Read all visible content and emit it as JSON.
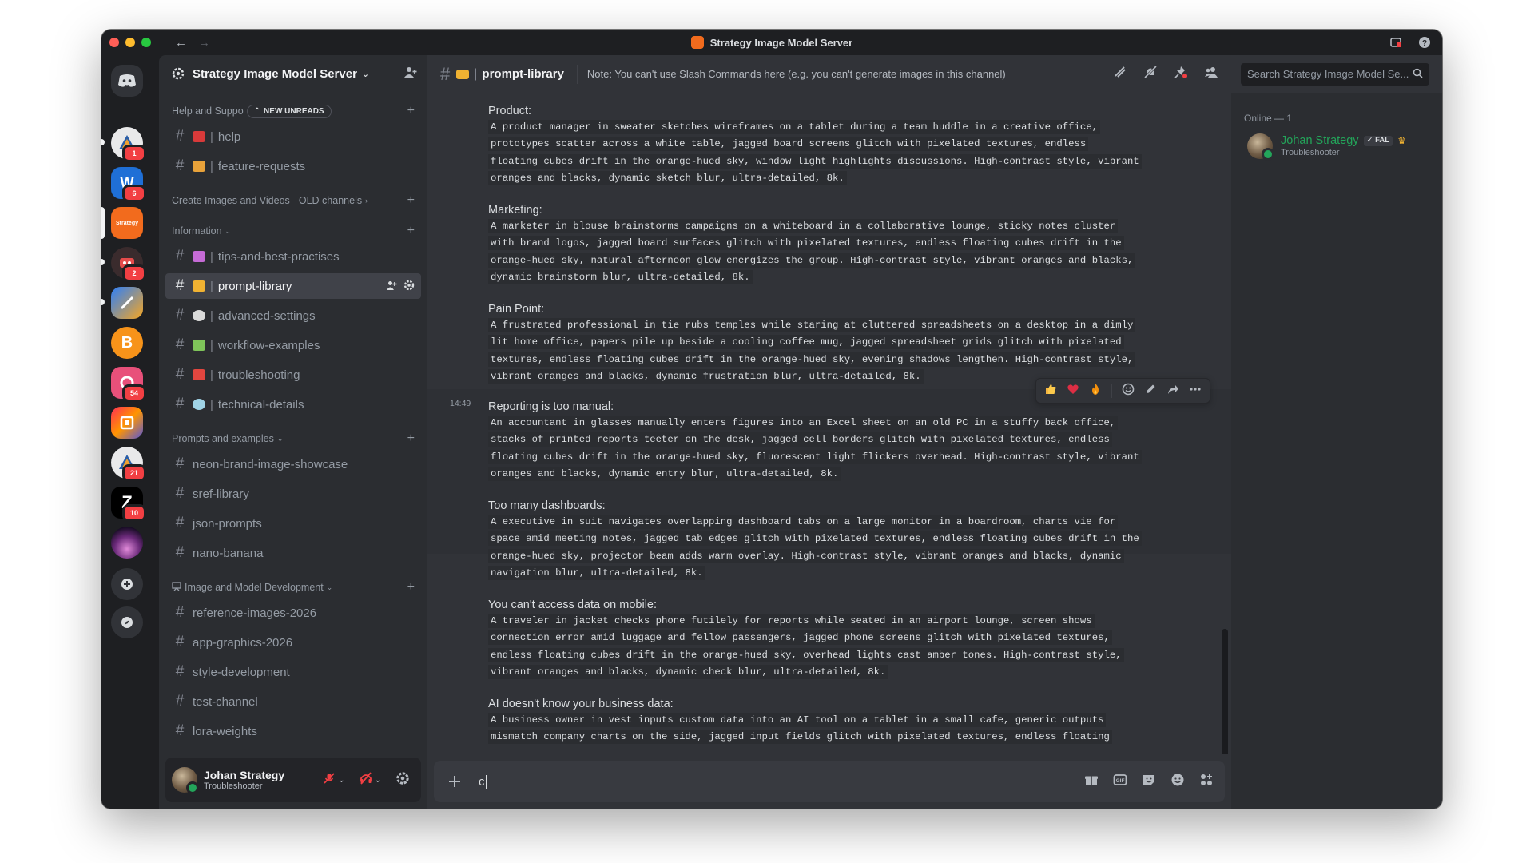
{
  "window": {
    "title": "Strategy Image Model Server"
  },
  "rail": {
    "servers": [
      {
        "name": "discord-home",
        "badge": ""
      },
      {
        "name": "server-1",
        "badge": "1"
      },
      {
        "name": "server-2",
        "badge": "6"
      },
      {
        "name": "strategy-server",
        "badge": ""
      },
      {
        "name": "server-4",
        "badge": "2"
      },
      {
        "name": "server-5",
        "badge": ""
      },
      {
        "name": "server-6",
        "badge": ""
      },
      {
        "name": "server-7",
        "badge": "54"
      },
      {
        "name": "server-8",
        "badge": ""
      },
      {
        "name": "server-9",
        "badge": "21"
      },
      {
        "name": "server-10",
        "badge": "10"
      },
      {
        "name": "server-11",
        "badge": ""
      }
    ],
    "strategy_logo_text": "Strategy"
  },
  "sidebar": {
    "server_name": "Strategy Image Model Server",
    "categories": {
      "help": {
        "label": "Help and Suppo",
        "new_unreads": "NEW UNREADS"
      },
      "create": {
        "label": "Create Images and Videos - OLD channels"
      },
      "information": {
        "label": "Information"
      },
      "prompts": {
        "label": "Prompts and examples"
      },
      "dev": {
        "label": "Image and Model Development"
      }
    },
    "channels": {
      "help": "help",
      "feature_requests": "feature-requests",
      "tips": "tips-and-best-practises",
      "prompt_library": "prompt-library",
      "advanced_settings": "advanced-settings",
      "workflow_examples": "workflow-examples",
      "troubleshooting": "troubleshooting",
      "technical_details": "technical-details",
      "neon": "neon-brand-image-showcase",
      "sref": "sref-library",
      "json": "json-prompts",
      "nano": "nano-banana",
      "reference": "reference-images-2026",
      "app_graphics": "app-graphics-2026",
      "style_dev": "style-development",
      "test_channel": "test-channel",
      "lora": "lora-weights"
    },
    "user": {
      "name": "Johan Strategy",
      "status": "Troubleshooter"
    }
  },
  "chat": {
    "channel_name": "prompt-library",
    "topic": "Note: You can't use Slash Commands here (e.g. you can't generate images in this channel)",
    "search_placeholder": "Search Strategy Image Model Se...",
    "timestamp": "14:49",
    "composer_value": "c",
    "blocks": [
      {
        "label": "Product:",
        "lines": [
          "A product manager in sweater sketches wireframes on a tablet during a team huddle in a creative office,",
          "prototypes scatter across a white table, jagged board screens glitch with pixelated textures, endless",
          "floating cubes drift in the orange-hued sky, window light highlights discussions. High-contrast style, vibrant",
          "oranges and blacks, dynamic sketch blur, ultra-detailed, 8k."
        ]
      },
      {
        "label": "Marketing:",
        "lines": [
          "A marketer in blouse brainstorms campaigns on a whiteboard in a collaborative lounge, sticky notes cluster",
          "with brand logos, jagged board surfaces glitch with pixelated textures, endless floating cubes drift in the",
          "orange-hued sky, natural afternoon glow energizes the group. High-contrast style, vibrant oranges and blacks,",
          "dynamic brainstorm blur, ultra-detailed, 8k."
        ]
      },
      {
        "label": "Pain Point:",
        "lines": [
          "A frustrated professional in tie rubs temples while staring at cluttered spreadsheets on a desktop in a dimly",
          "lit home office, papers pile up beside a cooling coffee mug, jagged spreadsheet grids glitch with pixelated",
          "textures, endless floating cubes drift in the orange-hued sky, evening shadows lengthen. High-contrast style,",
          "vibrant oranges and blacks, dynamic frustration blur, ultra-detailed, 8k."
        ]
      },
      {
        "label": "Reporting is too manual:",
        "lines": [
          "An accountant in glasses manually enters figures into an Excel sheet on an old PC in a stuffy back office,",
          "stacks of printed reports teeter on the desk, jagged cell borders glitch with pixelated textures, endless",
          "floating cubes drift in the orange-hued sky, fluorescent light flickers overhead. High-contrast style, vibrant",
          "oranges and blacks, dynamic entry blur, ultra-detailed, 8k."
        ]
      },
      {
        "label": "Too many dashboards:",
        "lines": [
          "A executive in suit navigates overlapping dashboard tabs on a large monitor in a boardroom, charts vie for",
          "space amid meeting notes, jagged tab edges glitch with pixelated textures, endless floating cubes drift in the",
          "orange-hued sky, projector beam adds warm overlay. High-contrast style, vibrant oranges and blacks, dynamic",
          "navigation blur, ultra-detailed, 8k."
        ]
      },
      {
        "label": "You can't access data on mobile:",
        "lines": [
          "A traveler in jacket checks phone futilely for reports while seated in an airport lounge, screen shows",
          "connection error amid luggage and fellow passengers, jagged phone screens glitch with pixelated textures,",
          "endless floating cubes drift in the orange-hued sky, overhead lights cast amber tones. High-contrast style,",
          "vibrant oranges and blacks, dynamic check blur, ultra-detailed, 8k."
        ]
      },
      {
        "label": "AI doesn't know your business data:",
        "lines": [
          "A business owner in vest inputs custom data into an AI tool on a tablet in a small cafe, generic outputs",
          "mismatch company charts on the side, jagged input fields glitch with pixelated textures, endless floating"
        ]
      }
    ]
  },
  "members": {
    "header": "Online — 1",
    "list": [
      {
        "name": "Johan Strategy",
        "tag": "FAL",
        "status": "Troubleshooter"
      }
    ]
  }
}
